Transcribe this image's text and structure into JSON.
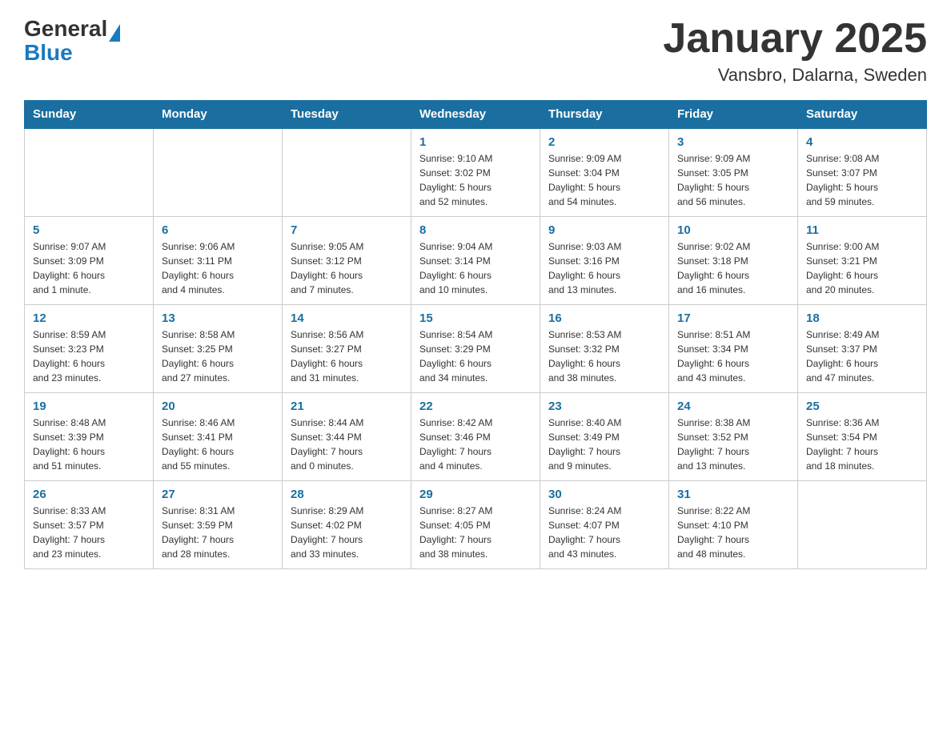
{
  "logo": {
    "text_general": "General",
    "text_blue": "Blue"
  },
  "title": "January 2025",
  "subtitle": "Vansbro, Dalarna, Sweden",
  "days_of_week": [
    "Sunday",
    "Monday",
    "Tuesday",
    "Wednesday",
    "Thursday",
    "Friday",
    "Saturday"
  ],
  "weeks": [
    [
      {
        "day": "",
        "info": ""
      },
      {
        "day": "",
        "info": ""
      },
      {
        "day": "",
        "info": ""
      },
      {
        "day": "1",
        "info": "Sunrise: 9:10 AM\nSunset: 3:02 PM\nDaylight: 5 hours\nand 52 minutes."
      },
      {
        "day": "2",
        "info": "Sunrise: 9:09 AM\nSunset: 3:04 PM\nDaylight: 5 hours\nand 54 minutes."
      },
      {
        "day": "3",
        "info": "Sunrise: 9:09 AM\nSunset: 3:05 PM\nDaylight: 5 hours\nand 56 minutes."
      },
      {
        "day": "4",
        "info": "Sunrise: 9:08 AM\nSunset: 3:07 PM\nDaylight: 5 hours\nand 59 minutes."
      }
    ],
    [
      {
        "day": "5",
        "info": "Sunrise: 9:07 AM\nSunset: 3:09 PM\nDaylight: 6 hours\nand 1 minute."
      },
      {
        "day": "6",
        "info": "Sunrise: 9:06 AM\nSunset: 3:11 PM\nDaylight: 6 hours\nand 4 minutes."
      },
      {
        "day": "7",
        "info": "Sunrise: 9:05 AM\nSunset: 3:12 PM\nDaylight: 6 hours\nand 7 minutes."
      },
      {
        "day": "8",
        "info": "Sunrise: 9:04 AM\nSunset: 3:14 PM\nDaylight: 6 hours\nand 10 minutes."
      },
      {
        "day": "9",
        "info": "Sunrise: 9:03 AM\nSunset: 3:16 PM\nDaylight: 6 hours\nand 13 minutes."
      },
      {
        "day": "10",
        "info": "Sunrise: 9:02 AM\nSunset: 3:18 PM\nDaylight: 6 hours\nand 16 minutes."
      },
      {
        "day": "11",
        "info": "Sunrise: 9:00 AM\nSunset: 3:21 PM\nDaylight: 6 hours\nand 20 minutes."
      }
    ],
    [
      {
        "day": "12",
        "info": "Sunrise: 8:59 AM\nSunset: 3:23 PM\nDaylight: 6 hours\nand 23 minutes."
      },
      {
        "day": "13",
        "info": "Sunrise: 8:58 AM\nSunset: 3:25 PM\nDaylight: 6 hours\nand 27 minutes."
      },
      {
        "day": "14",
        "info": "Sunrise: 8:56 AM\nSunset: 3:27 PM\nDaylight: 6 hours\nand 31 minutes."
      },
      {
        "day": "15",
        "info": "Sunrise: 8:54 AM\nSunset: 3:29 PM\nDaylight: 6 hours\nand 34 minutes."
      },
      {
        "day": "16",
        "info": "Sunrise: 8:53 AM\nSunset: 3:32 PM\nDaylight: 6 hours\nand 38 minutes."
      },
      {
        "day": "17",
        "info": "Sunrise: 8:51 AM\nSunset: 3:34 PM\nDaylight: 6 hours\nand 43 minutes."
      },
      {
        "day": "18",
        "info": "Sunrise: 8:49 AM\nSunset: 3:37 PM\nDaylight: 6 hours\nand 47 minutes."
      }
    ],
    [
      {
        "day": "19",
        "info": "Sunrise: 8:48 AM\nSunset: 3:39 PM\nDaylight: 6 hours\nand 51 minutes."
      },
      {
        "day": "20",
        "info": "Sunrise: 8:46 AM\nSunset: 3:41 PM\nDaylight: 6 hours\nand 55 minutes."
      },
      {
        "day": "21",
        "info": "Sunrise: 8:44 AM\nSunset: 3:44 PM\nDaylight: 7 hours\nand 0 minutes."
      },
      {
        "day": "22",
        "info": "Sunrise: 8:42 AM\nSunset: 3:46 PM\nDaylight: 7 hours\nand 4 minutes."
      },
      {
        "day": "23",
        "info": "Sunrise: 8:40 AM\nSunset: 3:49 PM\nDaylight: 7 hours\nand 9 minutes."
      },
      {
        "day": "24",
        "info": "Sunrise: 8:38 AM\nSunset: 3:52 PM\nDaylight: 7 hours\nand 13 minutes."
      },
      {
        "day": "25",
        "info": "Sunrise: 8:36 AM\nSunset: 3:54 PM\nDaylight: 7 hours\nand 18 minutes."
      }
    ],
    [
      {
        "day": "26",
        "info": "Sunrise: 8:33 AM\nSunset: 3:57 PM\nDaylight: 7 hours\nand 23 minutes."
      },
      {
        "day": "27",
        "info": "Sunrise: 8:31 AM\nSunset: 3:59 PM\nDaylight: 7 hours\nand 28 minutes."
      },
      {
        "day": "28",
        "info": "Sunrise: 8:29 AM\nSunset: 4:02 PM\nDaylight: 7 hours\nand 33 minutes."
      },
      {
        "day": "29",
        "info": "Sunrise: 8:27 AM\nSunset: 4:05 PM\nDaylight: 7 hours\nand 38 minutes."
      },
      {
        "day": "30",
        "info": "Sunrise: 8:24 AM\nSunset: 4:07 PM\nDaylight: 7 hours\nand 43 minutes."
      },
      {
        "day": "31",
        "info": "Sunrise: 8:22 AM\nSunset: 4:10 PM\nDaylight: 7 hours\nand 48 minutes."
      },
      {
        "day": "",
        "info": ""
      }
    ]
  ]
}
